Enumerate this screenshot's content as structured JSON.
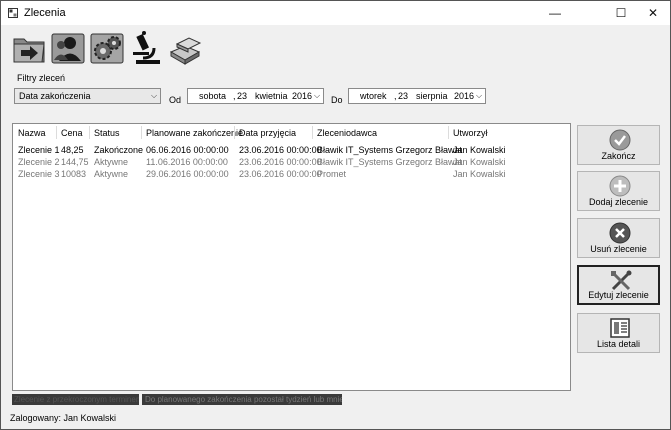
{
  "window": {
    "title": "Zlecenia",
    "controls": {
      "minimize": "—",
      "maximize": "☐",
      "close": "✕"
    }
  },
  "toolbar": {
    "tools": [
      {
        "icon": "folder-arrow-icon"
      },
      {
        "icon": "users-icon"
      },
      {
        "icon": "gears-icon"
      },
      {
        "icon": "microscope-icon"
      },
      {
        "icon": "metal-bars-icon"
      }
    ]
  },
  "filters": {
    "legend": "Filtry zleceń",
    "filter_by": "Data zakończenia",
    "od_label": "Od",
    "do_label": "Do",
    "date_from": {
      "weekday": "sobota",
      "sep": ",",
      "day": "23",
      "month": "kwietnia",
      "year": "2016"
    },
    "date_to": {
      "weekday": "wtorek",
      "sep": ",",
      "day": "23",
      "month": "sierpnia",
      "year": "2016"
    }
  },
  "orders": {
    "columns": [
      "Nazwa",
      "Cena",
      "Status",
      "Planowane zakończenie",
      "Data przyjęcia",
      "Zleceniodawca",
      "Utworzył"
    ],
    "rows": [
      [
        "Zlecenie 1",
        "48,25",
        "Zakończone",
        "06.06.2016 00:00:00",
        "23.06.2016 00:00:00",
        "Bławik IT_Systems Grzegorz Bławat",
        "Jan Kowalski"
      ],
      [
        "Zlecenie 2",
        "144,75",
        "Aktywne",
        "11.06.2016 00:00:00",
        "23.06.2016 00:00:00",
        "Bławik IT_Systems Grzegorz Bławat",
        "Jan Kowalski"
      ],
      [
        "Zlecenie 3",
        "10083",
        "Aktywne",
        "29.06.2016 00:00:00",
        "23.06.2016 00:00:00",
        "Promet",
        "Jan Kowalski"
      ]
    ]
  },
  "actions": {
    "finish": "Zakończ",
    "add": "Dodaj zlecenie",
    "remove": "Usuń zlecenie",
    "edit": "Edytuj zlecenie",
    "parts": "Lista detali"
  },
  "legend": {
    "late": "Zlecenie z przekroczonym terminem",
    "soon": "Do planowanego zakończenia pozostał tydzień lub mniej"
  },
  "status": {
    "logged_in": "Zalogowany: Jan Kowalski"
  }
}
